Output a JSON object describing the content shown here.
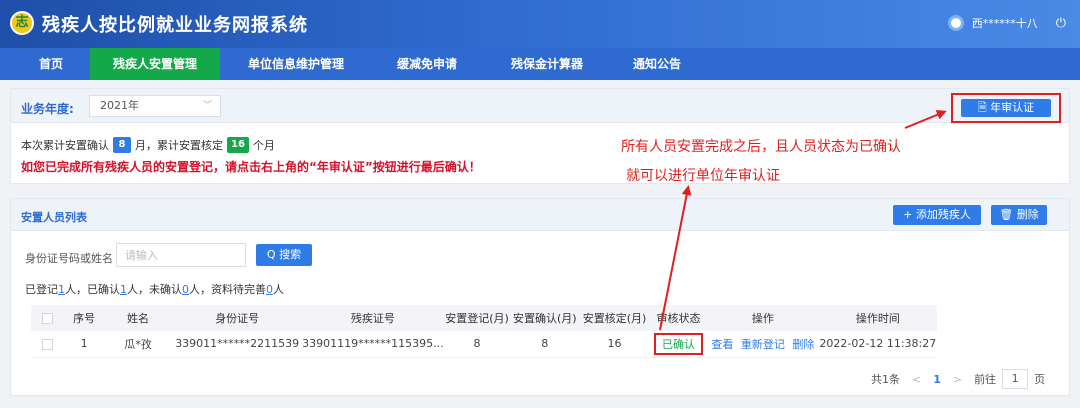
{
  "header": {
    "logo_glyph": "志",
    "title": "残疾人按比例就业业务网报系统",
    "user": "西******十八",
    "power_glyph": "⏻"
  },
  "nav": [
    "首页",
    "残疾人安置管理",
    "单位信息维护管理",
    "缓减免申请",
    "残保金计算器",
    "通知公告"
  ],
  "year": {
    "label": "业务年度:",
    "value": "2021年",
    "chevron": "﹀"
  },
  "annual_button": "🗎 年审认证",
  "summary": {
    "prefix": "本次累计安置确认",
    "confirm_months": "8",
    "mid": "月，累计安置核定",
    "approved_months": "16",
    "suffix": "个月"
  },
  "warning": "如您已完成所有残疾人员的安置登记，请点击右上角的“年审认证”按钮进行最后确认！",
  "annotation": {
    "line1": "所有人员安置完成之后，且人员状态为已确认",
    "line2": "就可以进行单位年审认证"
  },
  "list": {
    "title": "安置人员列表",
    "add_button": "+ 添加残疾人",
    "delete_button": "🗑 删除",
    "search_label": "身份证号码或姓名",
    "search_placeholder": "请输入",
    "search_button": "Q 搜索",
    "stats": {
      "t1": "已登记",
      "registered": "1",
      "t2": "人，已确认",
      "confirmed": "1",
      "t3": "人，未确认",
      "unconfirmed": "0",
      "t4": "人，资料待完善",
      "pending": "0",
      "t5": "人"
    },
    "columns": [
      "序号",
      "姓名",
      "身份证号",
      "残疾证号",
      "安置登记(月)",
      "安置确认(月)",
      "安置核定(月)",
      "审核状态",
      "操作",
      "操作时间"
    ],
    "rows": [
      {
        "no": "1",
        "name": "瓜*孜",
        "id": "339011******2211539",
        "card": "33901119******115395...",
        "reg": "8",
        "confirm": "8",
        "approved": "16",
        "status": "已确认",
        "ops": [
          "查看",
          "重新登记",
          "删除"
        ],
        "time": "2022-02-12 11:38:27"
      }
    ]
  },
  "pager": {
    "total": "共1条",
    "prev": "<",
    "page": "1",
    "next": ">",
    "goto_label": "前往",
    "goto_value": "1",
    "unit": "页"
  },
  "colors": {
    "accent": "#2f7be8",
    "active_nav": "#13a84a",
    "annotation": "#e02020"
  }
}
